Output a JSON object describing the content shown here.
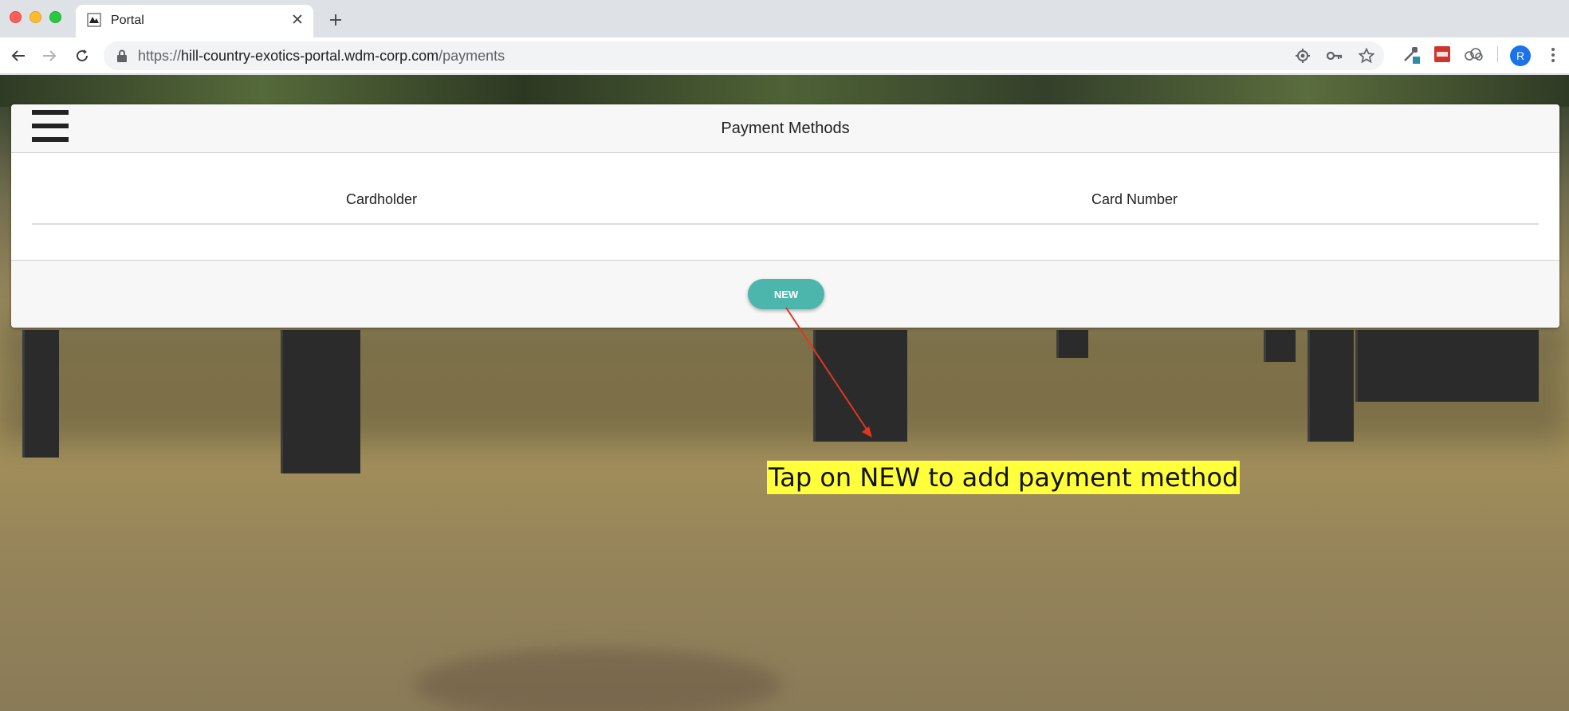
{
  "browser": {
    "tab": {
      "title": "Portal"
    },
    "address_bar": {
      "protocol": "https://",
      "host": "hill-country-exotics-portal.wdm-corp.com",
      "path": "/payments"
    },
    "profile_initial": "R",
    "icons": [
      "back-icon",
      "forward-icon",
      "reload-icon",
      "lock-icon",
      "location-icon",
      "key-icon",
      "star-icon",
      "eyedropper-extension-icon",
      "red-extension-icon",
      "cloud-extension-icon",
      "menu-icon"
    ]
  },
  "page": {
    "title": "Payment Methods",
    "table": {
      "columns": [
        "Cardholder",
        "Card Number"
      ],
      "rows": []
    },
    "new_button_label": "NEW"
  },
  "annotation": {
    "text": "Tap on NEW to add payment method",
    "highlight_color": "#ffff3c",
    "arrow_color": "#e5341f"
  },
  "colors": {
    "accent": "#4db6ac"
  }
}
